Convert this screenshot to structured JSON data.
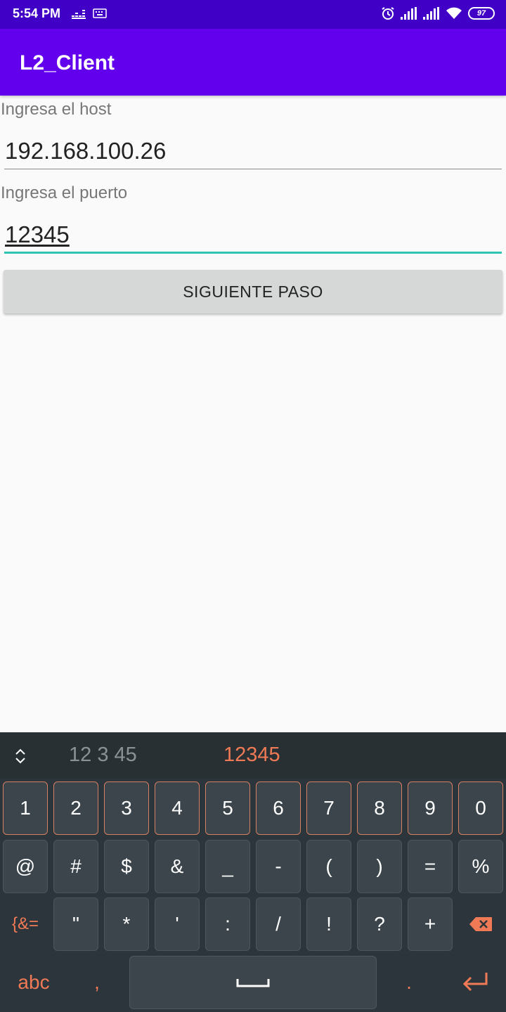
{
  "status": {
    "time": "5:54 PM",
    "battery": "97"
  },
  "app": {
    "title": "L2_Client"
  },
  "form": {
    "host_label": "Ingresa el host",
    "host_value": "192.168.100.26",
    "port_label": "Ingresa el puerto",
    "port_value": "12345",
    "next_button": "SIGUIENTE PASO"
  },
  "keyboard": {
    "suggestions": [
      "12 3 45",
      "12345"
    ],
    "row1": [
      "1",
      "2",
      "3",
      "4",
      "5",
      "6",
      "7",
      "8",
      "9",
      "0"
    ],
    "row2": [
      "@",
      "#",
      "$",
      "&",
      "_",
      "-",
      "(",
      ")",
      "=",
      "%"
    ],
    "row3_switch": "{&=",
    "row3": [
      "\"",
      "*",
      "'",
      ":",
      "/",
      "!",
      "?",
      "+"
    ],
    "abc": "abc",
    "comma": ",",
    "period": ".",
    "accent_color": "#f07a55"
  }
}
